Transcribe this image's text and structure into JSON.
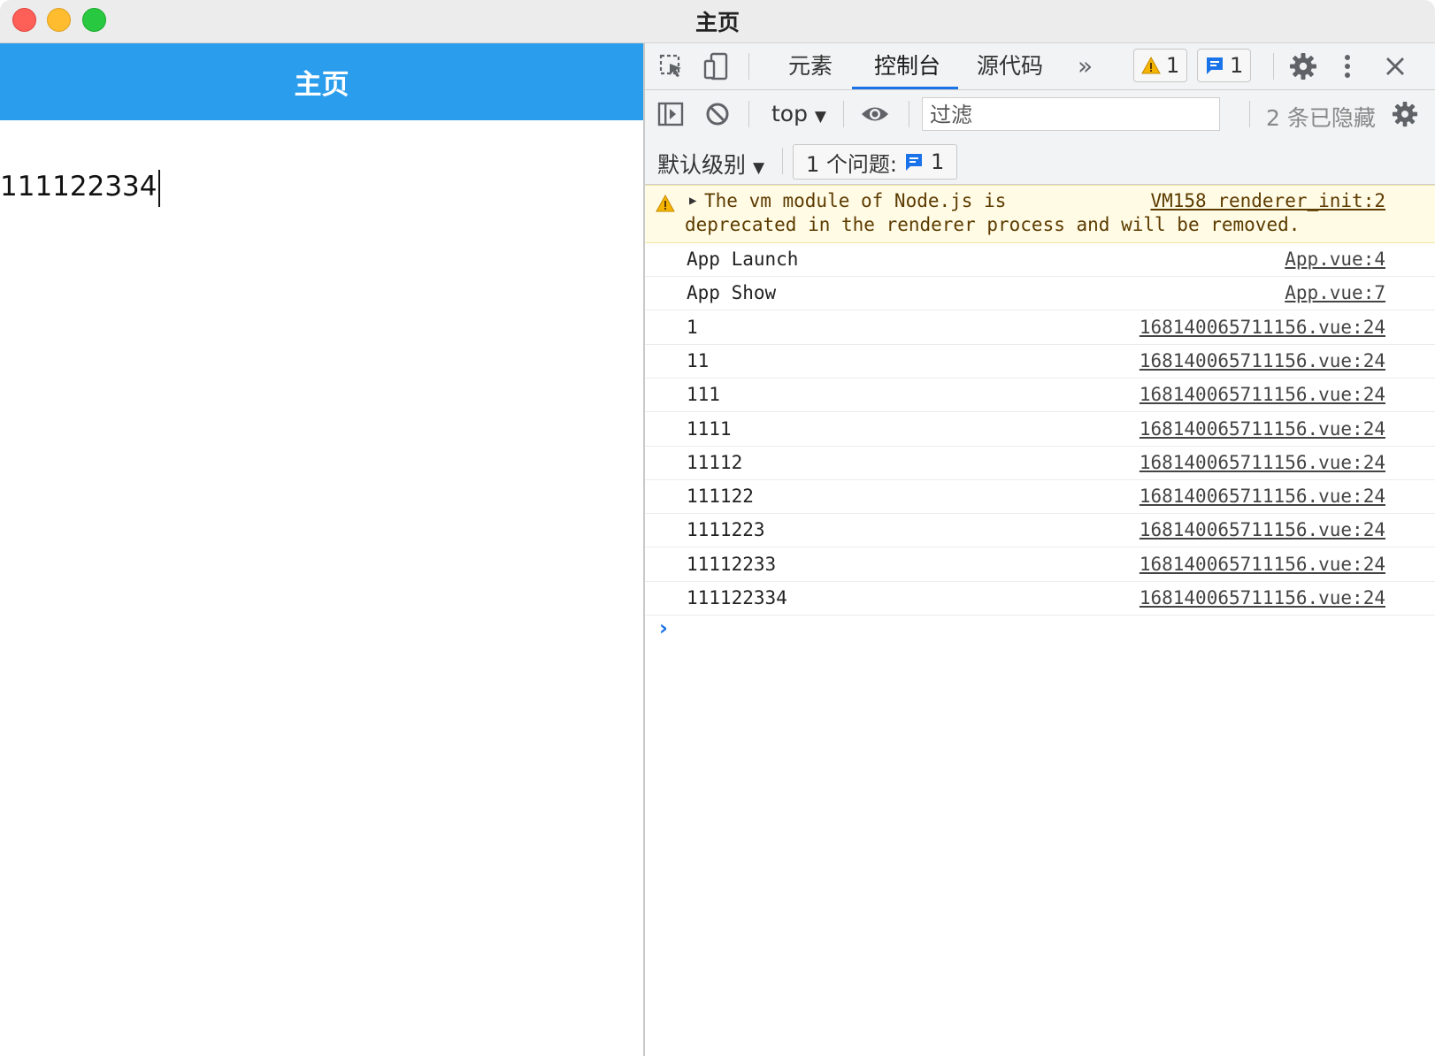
{
  "window": {
    "title": "主页"
  },
  "app": {
    "nav_title": "主页",
    "input_value": "111122334"
  },
  "devtools": {
    "tabs": [
      {
        "label": "元素"
      },
      {
        "label": "控制台"
      },
      {
        "label": "源代码"
      }
    ],
    "more_tabs_glyph": "»",
    "warning_count": "1",
    "info_count": "1",
    "context_select": "top",
    "filter_placeholder": "过滤",
    "hidden_text": "2 条已隐藏",
    "level_select": "默认级别",
    "issues_label": "1 个问题:",
    "issues_count": "1"
  },
  "console": {
    "warning": {
      "message_line1": "The vm module of Node.js is",
      "message_line2": "deprecated in the renderer process and will be removed.",
      "source": "VM158 renderer_init:2"
    },
    "rows": [
      {
        "message": "App Launch",
        "source": "App.vue:4"
      },
      {
        "message": "App Show",
        "source": "App.vue:7"
      },
      {
        "message": "1",
        "source": "168140065711156.vue:24"
      },
      {
        "message": "11",
        "source": "168140065711156.vue:24"
      },
      {
        "message": "111",
        "source": "168140065711156.vue:24"
      },
      {
        "message": "1111",
        "source": "168140065711156.vue:24"
      },
      {
        "message": "11112",
        "source": "168140065711156.vue:24"
      },
      {
        "message": "111122",
        "source": "168140065711156.vue:24"
      },
      {
        "message": "1111223",
        "source": "168140065711156.vue:24"
      },
      {
        "message": "11112233",
        "source": "168140065711156.vue:24"
      },
      {
        "message": "111122334",
        "source": "168140065711156.vue:24"
      }
    ],
    "prompt_glyph": "›"
  }
}
